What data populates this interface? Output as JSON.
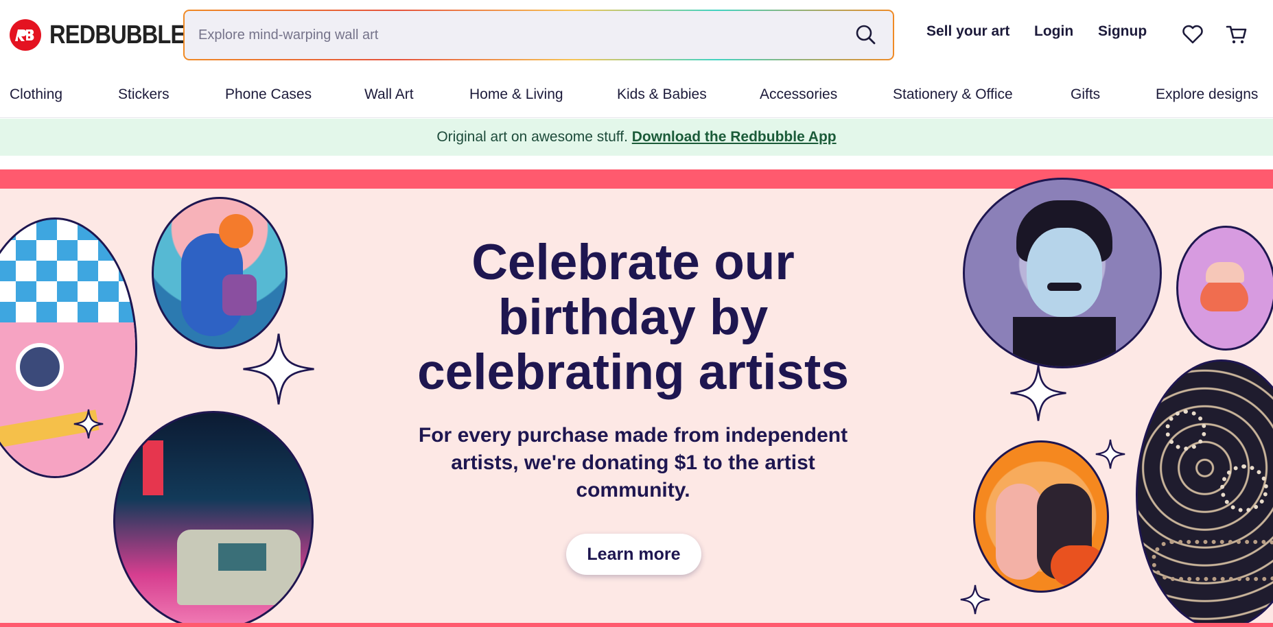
{
  "header": {
    "logo_text": "REDBUBBLE",
    "search_placeholder": "Explore mind-warping wall art",
    "sell_label": "Sell your art",
    "login_label": "Login",
    "signup_label": "Signup"
  },
  "categories": [
    "Clothing",
    "Stickers",
    "Phone Cases",
    "Wall Art",
    "Home & Living",
    "Kids & Babies",
    "Accessories",
    "Stationery & Office",
    "Gifts",
    "Explore designs"
  ],
  "promo": {
    "text": "Original art on awesome stuff. ",
    "link": "Download the Redbubble App"
  },
  "hero": {
    "title": "Celebrate our birthday by celebrating artists",
    "subtitle": "For every purchase made from independent artists, we're donating $1 to the artist community.",
    "cta": "Learn more"
  },
  "colors": {
    "brand_red": "#e41321",
    "hero_band": "#ff5a6e",
    "hero_bg": "#fde8e5",
    "ink": "#1e1650",
    "promo_bg": "#e3f7ea"
  },
  "icons": [
    "search-icon",
    "heart-icon",
    "cart-icon",
    "sparkle-icon"
  ]
}
